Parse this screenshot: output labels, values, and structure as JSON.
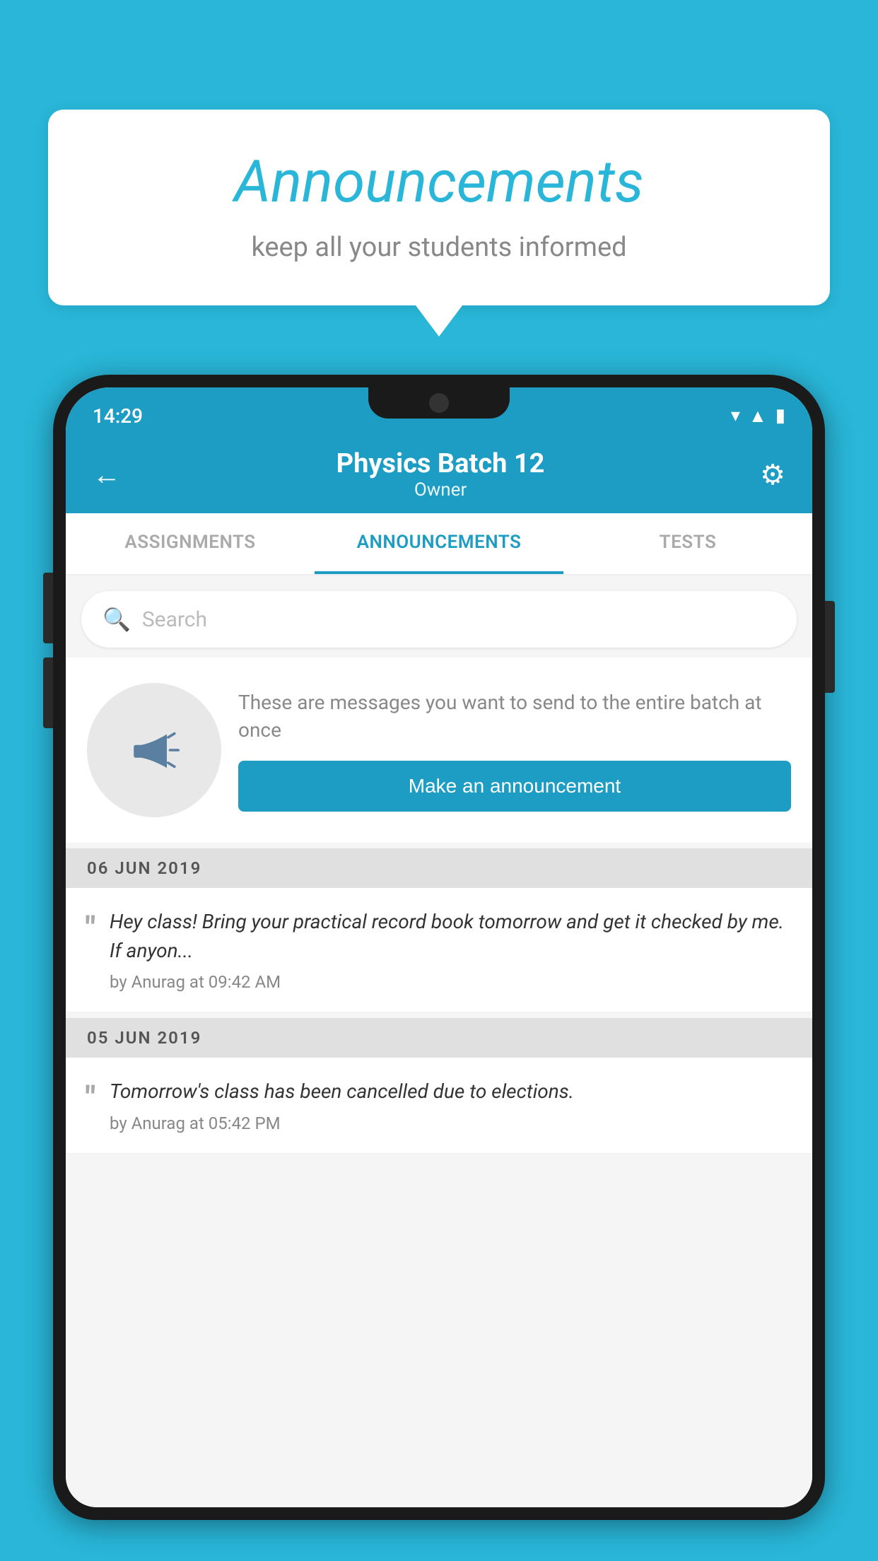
{
  "background_color": "#29b6d8",
  "speech_bubble": {
    "title": "Announcements",
    "subtitle": "keep all your students informed"
  },
  "phone": {
    "status_bar": {
      "time": "14:29",
      "icons": [
        "wifi",
        "signal",
        "battery"
      ]
    },
    "header": {
      "title": "Physics Batch 12",
      "subtitle": "Owner",
      "back_label": "←",
      "gear_label": "⚙"
    },
    "tabs": [
      {
        "label": "ASSIGNMENTS",
        "active": false
      },
      {
        "label": "ANNOUNCEMENTS",
        "active": true
      },
      {
        "label": "TESTS",
        "active": false
      },
      {
        "label": "...",
        "active": false
      }
    ],
    "search": {
      "placeholder": "Search"
    },
    "promo": {
      "description": "These are messages you want to send to the entire batch at once",
      "button_label": "Make an announcement"
    },
    "announcements": [
      {
        "date": "06  JUN  2019",
        "text": "Hey class! Bring your practical record book tomorrow and get it checked by me. If anyon...",
        "meta": "by Anurag at 09:42 AM"
      },
      {
        "date": "05  JUN  2019",
        "text": "Tomorrow's class has been cancelled due to elections.",
        "meta": "by Anurag at 05:42 PM"
      }
    ]
  }
}
